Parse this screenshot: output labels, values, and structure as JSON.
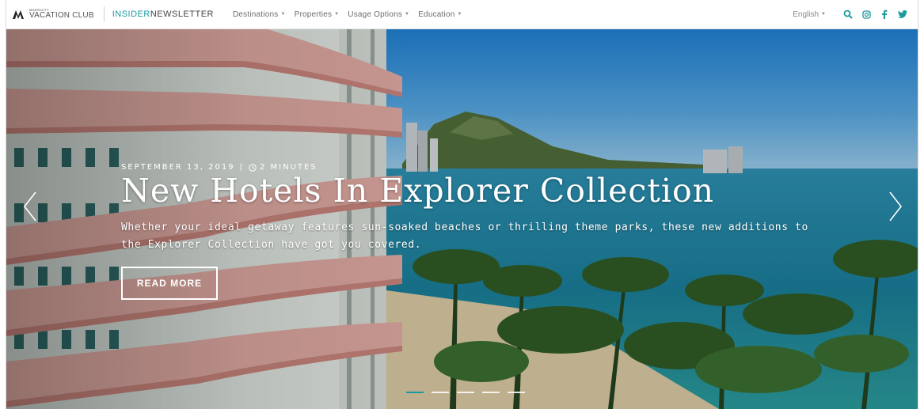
{
  "nav": {
    "logo_top": "MARRIOTT",
    "logo_bottom": "VACATION CLUB",
    "brand_part1": "INSIDER",
    "brand_part2": "NEWSLETTER",
    "menu": [
      {
        "label": "Destinations"
      },
      {
        "label": "Properties"
      },
      {
        "label": "Usage Options"
      },
      {
        "label": "Education"
      }
    ],
    "language": "English",
    "icons": [
      "search-icon",
      "instagram-icon",
      "facebook-icon",
      "twitter-icon"
    ]
  },
  "hero": {
    "date": "SEPTEMBER 13, 2019",
    "separator": "|",
    "read_time": "2 MINUTES",
    "title": "New Hotels In Explorer Collection",
    "summary": "Whether your ideal getaway features sun-soaked beaches or thrilling theme parks, these new additions to the Explorer Collection have got you covered.",
    "button": "READ MORE",
    "slides": 5,
    "active_slide": 1
  },
  "colors": {
    "accent": "#1a9aa0",
    "brand_dark": "#444444",
    "text_on_image": "#ffffff"
  }
}
